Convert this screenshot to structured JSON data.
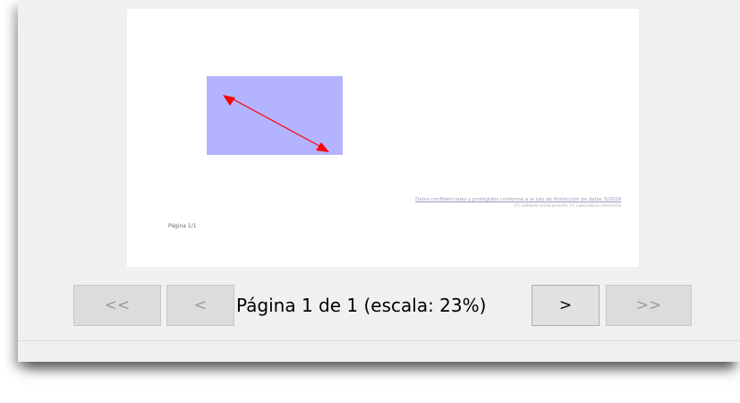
{
  "preview": {
    "footer_notice": "Datos confidenciales y protegidos conforme a la Ley de Protección de datos 3/2018",
    "footer_legend": "(T) validado técnicamente, (*) Laboratorio referencia",
    "page_label": "Página 1/1",
    "shape_fill": "#b3b3ff",
    "arrow_color": "#ff0000"
  },
  "navigation": {
    "first_label": "<<",
    "prev_label": "<",
    "status": "Página 1 de 1 (escala: 23%)",
    "next_label": ">",
    "last_label": ">>"
  }
}
